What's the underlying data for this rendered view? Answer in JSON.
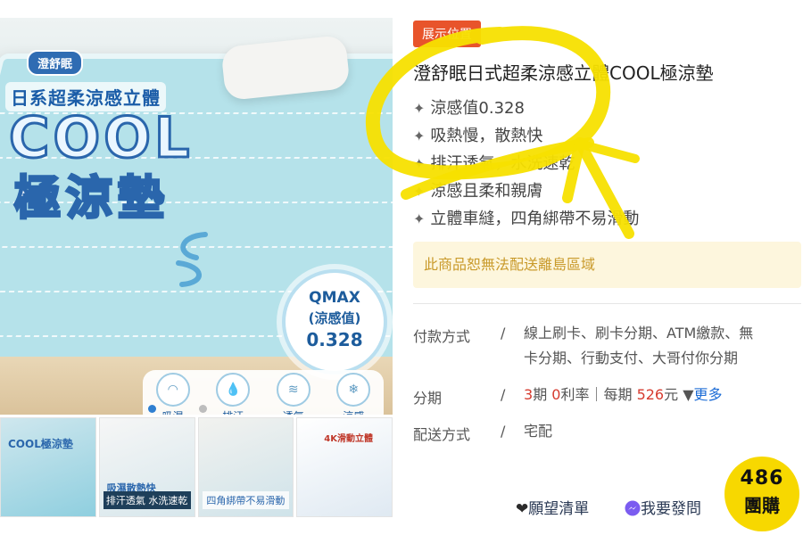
{
  "gallery": {
    "brand": "澄舒眠",
    "subtitle": "日系超柔涼感立體",
    "hero_word": "COOL",
    "hero_title": "極涼墊",
    "qmax": {
      "line1": "QMAX",
      "line2": "(涼感值)",
      "line3": "0.328"
    },
    "features": [
      {
        "label": "吸濕",
        "icon": "humidity-icon"
      },
      {
        "label": "排汗",
        "icon": "sweat-icon"
      },
      {
        "label": "透氣",
        "icon": "breathable-icon"
      },
      {
        "label": "涼感",
        "icon": "snowflake-icon"
      }
    ],
    "thumbnails": [
      {
        "label": "COOL極涼墊",
        "caption": ""
      },
      {
        "label": "吸濕散熱快",
        "caption": "排汗透氣 水洗速乾"
      },
      {
        "label": "",
        "caption": "四角綁帶不易滑動"
      },
      {
        "label": "",
        "caption": "4K滑動立體"
      }
    ]
  },
  "product": {
    "promo_badge": "展示位置",
    "title": "澄舒眠日式超柔涼感立體COOL極涼墊",
    "features": [
      "涼感值0.328",
      "吸熱慢，散熱快",
      "排汗透氣，水洗速乾",
      "涼感且柔和親膚",
      "立體車縫，四角綁帶不易滑動"
    ],
    "notice": "此商品恕無法配送離島區域"
  },
  "info": {
    "payment_label": "付款方式",
    "payment_line1": "線上刷卡、刷卡分期、ATM繳款、無",
    "payment_line2": "卡分期、行動支付、大哥付你分期",
    "installment_label": "分期",
    "installment_count": "3",
    "installment_text1": "期 ",
    "installment_rate": "0",
    "installment_text2": "利率｜每期 ",
    "installment_amount": "526",
    "installment_text3": "元 ▼",
    "installment_more": "更多",
    "shipping_label": "配送方式",
    "shipping_value": "宅配",
    "separator": "/"
  },
  "actions": {
    "wishlist": "願望清單",
    "invoice": "我要發問"
  },
  "logo": {
    "number": "486",
    "word": "團購"
  },
  "colors": {
    "accent_red": "#d63b2f",
    "link_blue": "#1e6dd6",
    "badge_orange": "#e8542b",
    "annotation_yellow": "#f7e000"
  }
}
